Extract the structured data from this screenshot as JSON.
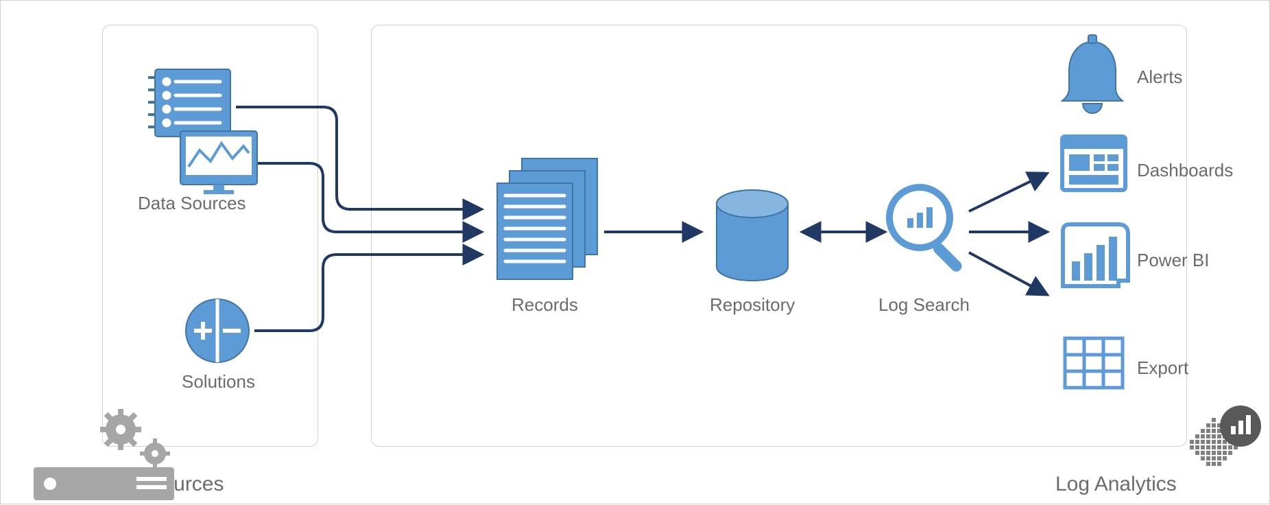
{
  "labels": {
    "connected_sources": "Connected Sources",
    "data_sources": "Data Sources",
    "solutions": "Solutions",
    "records": "Records",
    "repository": "Repository",
    "log_search": "Log Search",
    "alerts": "Alerts",
    "dashboards": "Dashboards",
    "powerbi": "Power BI",
    "export": "Export",
    "log_analytics": "Log Analytics"
  },
  "colors": {
    "blue_fill": "#5c9bd5",
    "blue_stroke": "#3f74a3",
    "navy": "#1f3864",
    "gray": "#a6a6a6",
    "dark_gray": "#7f7f7f",
    "text": "#6b6b6b",
    "border": "#d0d0d0"
  }
}
